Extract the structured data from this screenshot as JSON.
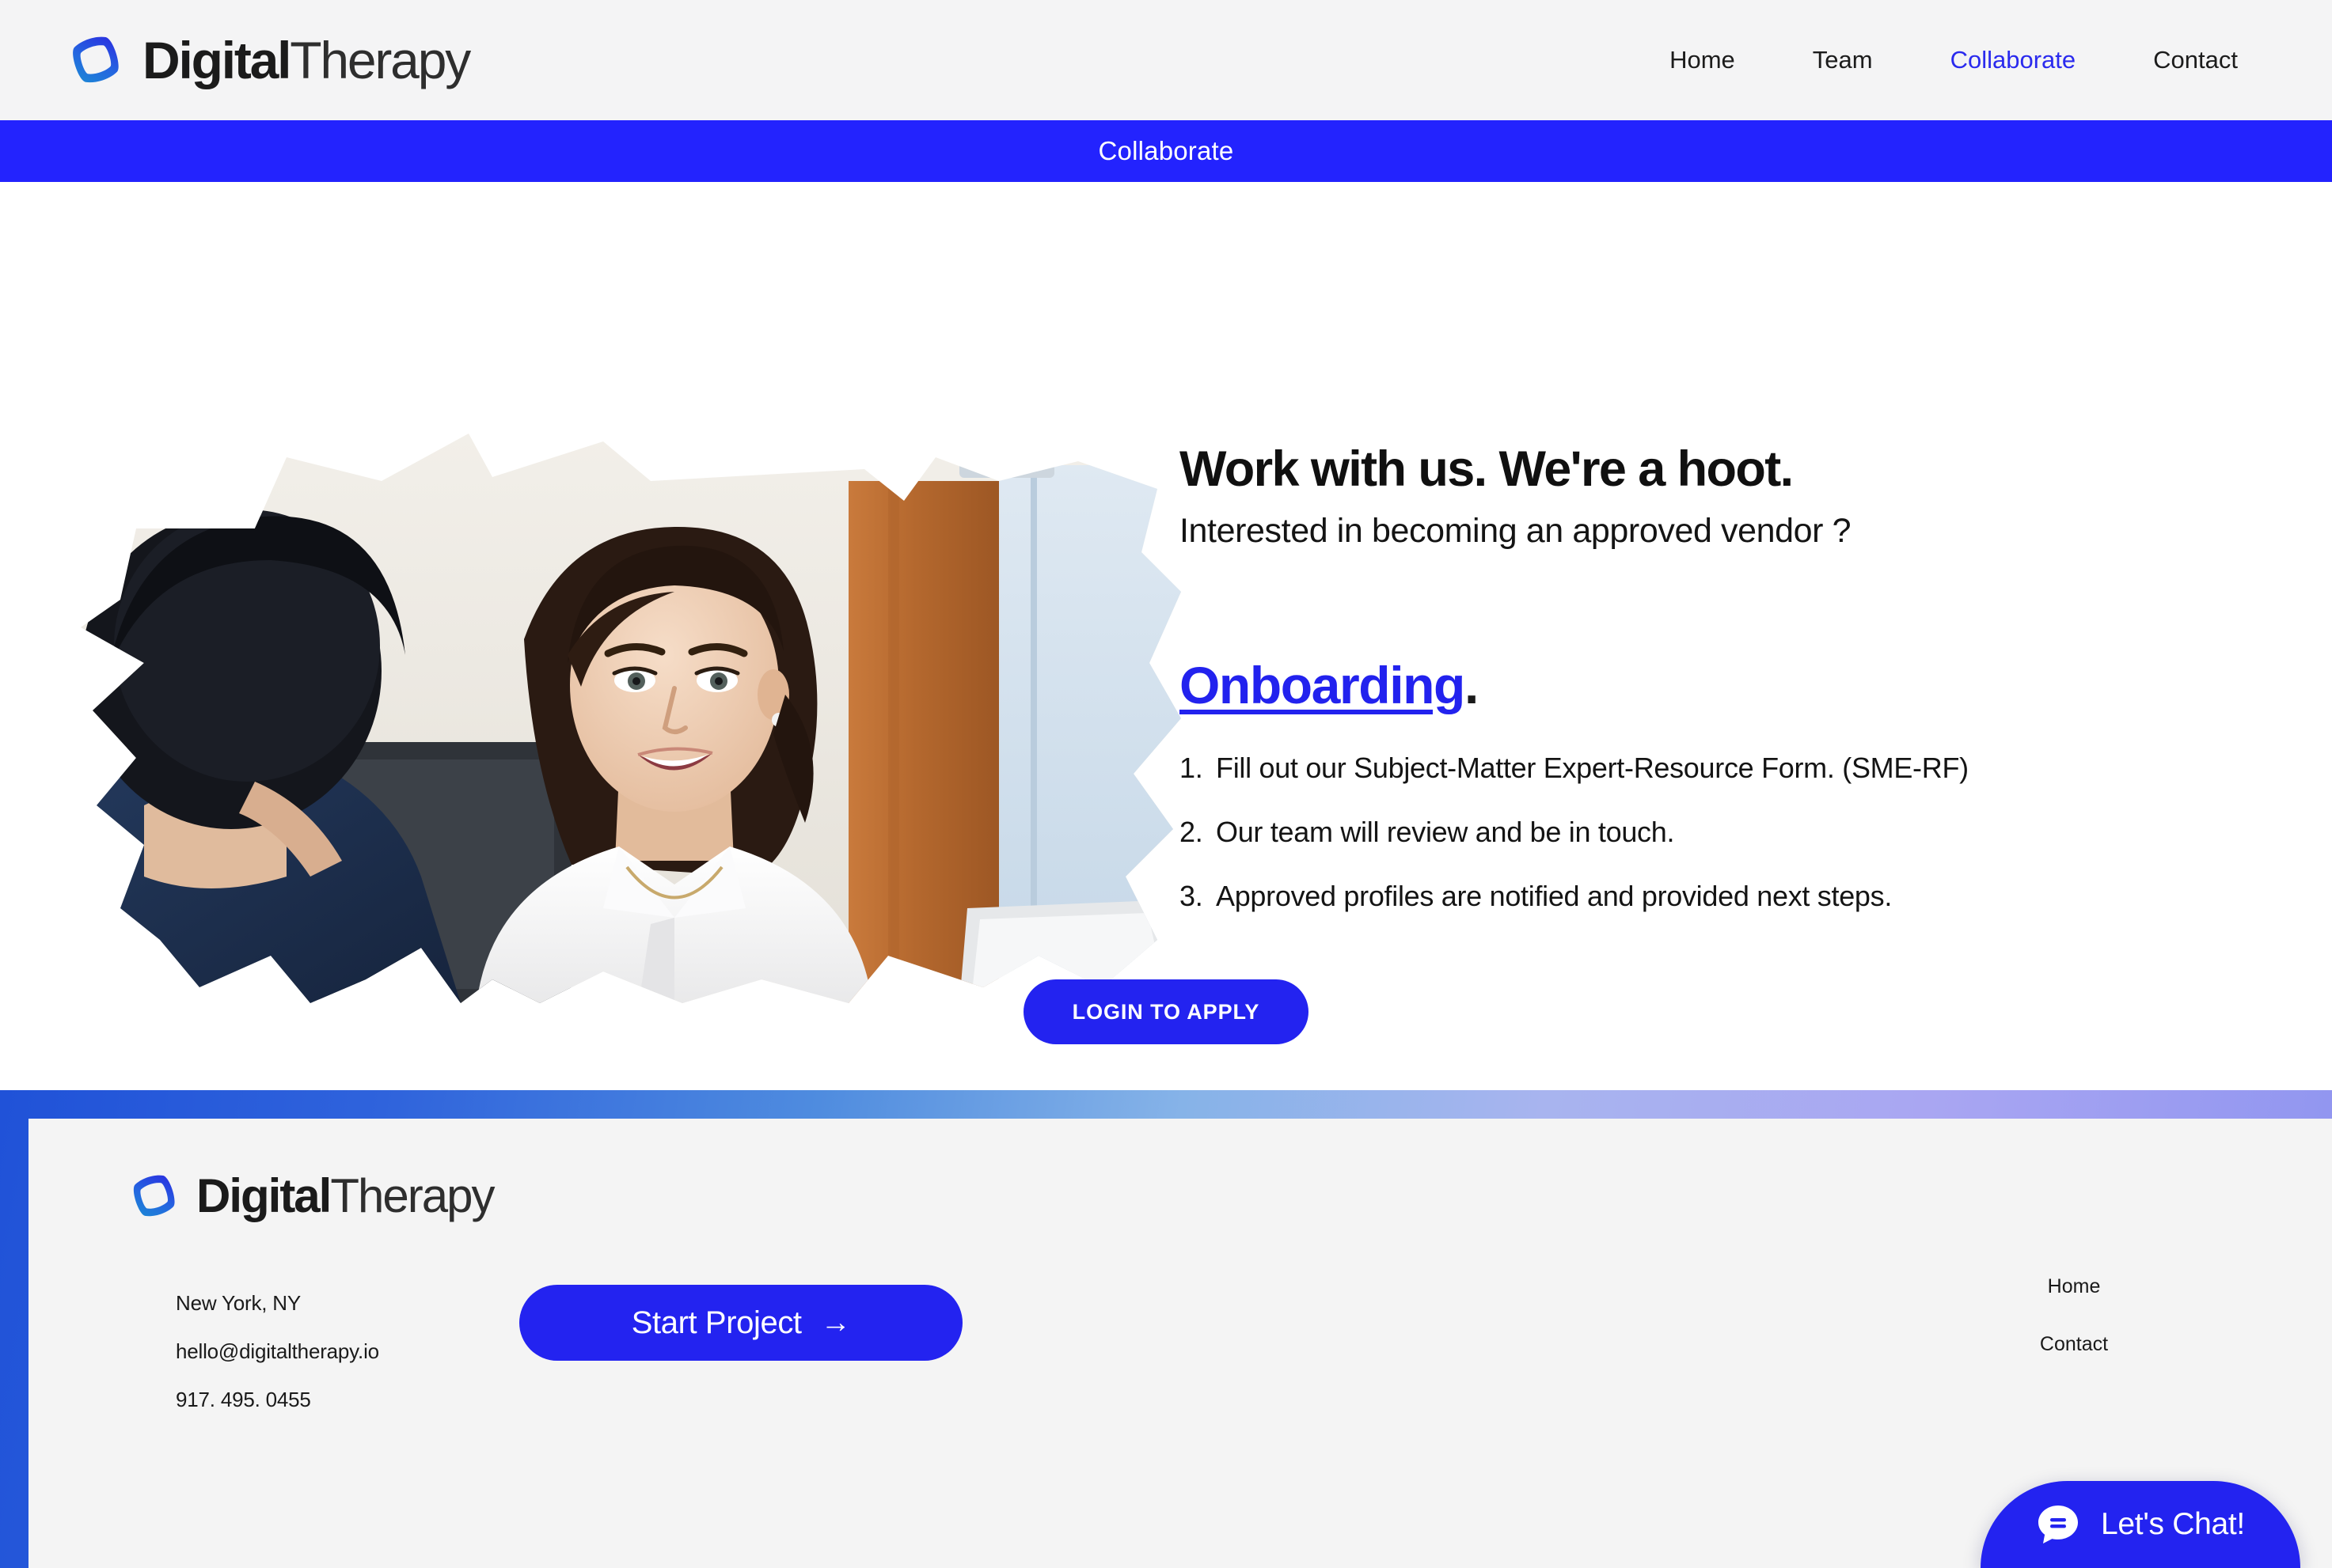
{
  "header": {
    "brand": {
      "bold_part": "Digital",
      "light_part": "Therapy",
      "mark_name": "digitaltherapy-logo-icon"
    },
    "nav": [
      {
        "label": "Home",
        "active": false
      },
      {
        "label": "Team",
        "active": false
      },
      {
        "label": "Collaborate",
        "active": true
      },
      {
        "label": "Contact",
        "active": false
      }
    ]
  },
  "banner": {
    "text": "Collaborate",
    "background_color": "#2323fe",
    "text_color": "#ffffff"
  },
  "hero": {
    "image_alt": "Two business people in a meeting, man in navy suit facing a smiling woman in a white shirt at an office desk",
    "title": "Work with us. We're a hoot.",
    "subtitle": "Interested in becoming an approved vendor ?",
    "onboarding_heading": "Onboarding",
    "onboarding_heading_period": ".",
    "onboarding_link_color": "#2222ee",
    "steps": [
      {
        "number": "1.",
        "text": "Fill out our Subject-Matter Expert-Resource Form. (SME-RF)"
      },
      {
        "number": "2.",
        "text": "Our team will review and be in touch."
      },
      {
        "number": "3.",
        "text": "Approved profiles are notified and provided next steps."
      }
    ],
    "cta_label": "LOGIN TO APPLY",
    "cta_color": "#2323f0"
  },
  "footer": {
    "brand": {
      "bold_part": "Digital",
      "light_part": "Therapy",
      "mark_name": "digitaltherapy-logo-icon"
    },
    "contact": [
      "New York, NY",
      "hello@digitaltherapy.io",
      "917. 495. 0455"
    ],
    "cta_label": "Start Project",
    "cta_arrow": "→",
    "nav": [
      {
        "label": "Home"
      },
      {
        "label": "Contact"
      }
    ],
    "border_gradient_start": "#2052d8",
    "border_gradient_end": "#8d93f0",
    "panel_color": "#f4f4f4"
  },
  "chat_widget": {
    "label": "Let's Chat!",
    "icon_name": "chat-bubble-icon",
    "background_color": "#2323f0"
  }
}
